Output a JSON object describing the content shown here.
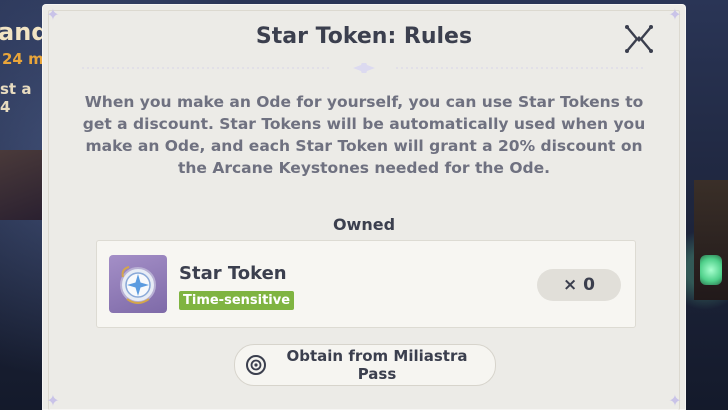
{
  "background": {
    "partial_text_1": "and",
    "partial_text_2": "24 m",
    "partial_text_3": "st a 4"
  },
  "dialog": {
    "title": "Star Token: Rules",
    "description": "When you make an Ode for yourself, you can use Star Tokens to get a discount. Star Tokens will be automatically used when you make an Ode, and each Star Token will grant a 20% discount on the Arcane Keystones needed for the Ode.",
    "owned_label": "Owned",
    "item": {
      "name": "Star Token",
      "badge": "Time-sensitive",
      "count": "× 0",
      "icon": "star-token-icon"
    },
    "obtain_button": {
      "label": "Obtain from Miliastra Pass",
      "icon": "pass-icon"
    },
    "close_icon": "close-icon"
  },
  "colors": {
    "panel": "#ecebe7",
    "title_text": "#3b3f4e",
    "body_text": "#6f7180",
    "badge_green": "#7fb441"
  }
}
